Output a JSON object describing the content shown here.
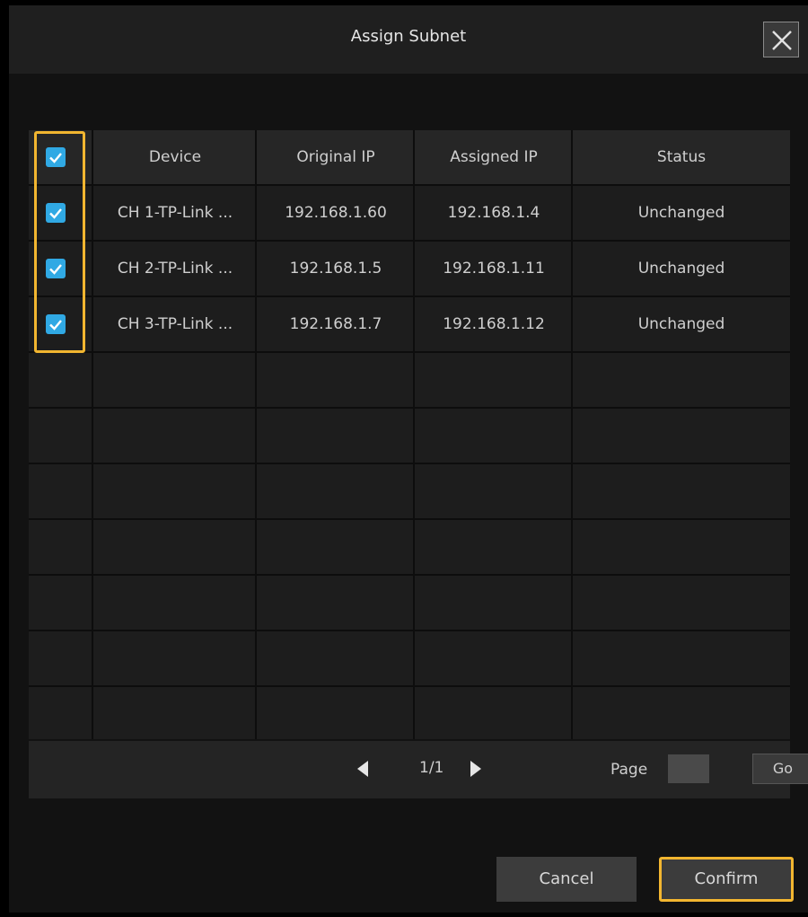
{
  "dialog": {
    "title": "Assign Subnet",
    "close_icon": "close-icon"
  },
  "table": {
    "columns": [
      "Device",
      "Original IP",
      "Assigned IP",
      "Status"
    ],
    "select_all_checked": true,
    "rows": [
      {
        "checked": true,
        "device": "CH 1-TP-Link ...",
        "original_ip": "192.168.1.60",
        "assigned_ip": "192.168.1.4",
        "status": "Unchanged"
      },
      {
        "checked": true,
        "device": "CH 2-TP-Link ...",
        "original_ip": "192.168.1.5",
        "assigned_ip": "192.168.1.11",
        "status": "Unchanged"
      },
      {
        "checked": true,
        "device": "CH 3-TP-Link ...",
        "original_ip": "192.168.1.7",
        "assigned_ip": "192.168.1.12",
        "status": "Unchanged"
      }
    ],
    "empty_rows": 7
  },
  "pager": {
    "page_indicator": "1/1",
    "page_label": "Page",
    "page_input_value": "",
    "go_label": "Go"
  },
  "footer": {
    "cancel_label": "Cancel",
    "confirm_label": "Confirm"
  },
  "colors": {
    "highlight": "#f2b630",
    "checkbox": "#30a9e4",
    "background": "#121212"
  }
}
